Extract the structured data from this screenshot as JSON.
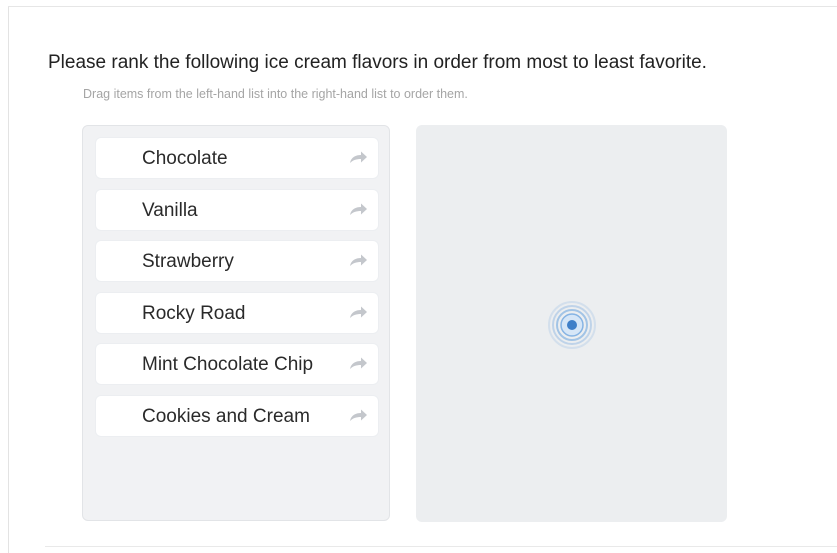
{
  "survey": {
    "question": "Please rank the following ice cream flavors in order from most to least favorite.",
    "instruction": "Drag items from the left-hand list into the right-hand list to order them."
  },
  "source_list": {
    "items": [
      {
        "label": "Chocolate",
        "icon": "move-right-arrow-icon"
      },
      {
        "label": "Vanilla",
        "icon": "move-right-arrow-icon"
      },
      {
        "label": "Strawberry",
        "icon": "move-right-arrow-icon"
      },
      {
        "label": "Rocky Road",
        "icon": "move-right-arrow-icon"
      },
      {
        "label": "Mint Chocolate Chip",
        "icon": "move-right-arrow-icon"
      },
      {
        "label": "Cookies and Cream",
        "icon": "move-right-arrow-icon"
      }
    ]
  },
  "target_list": {
    "items": [],
    "indicator_icon": "touch-ripple-icon"
  },
  "colors": {
    "text": "#222222",
    "instruction": "#a5a5a5",
    "source_bg": "#f1f2f4",
    "target_bg": "#eceef0",
    "item_bg": "#ffffff",
    "arrow": "#c4c7cc",
    "indicator": "#4a90d9"
  }
}
